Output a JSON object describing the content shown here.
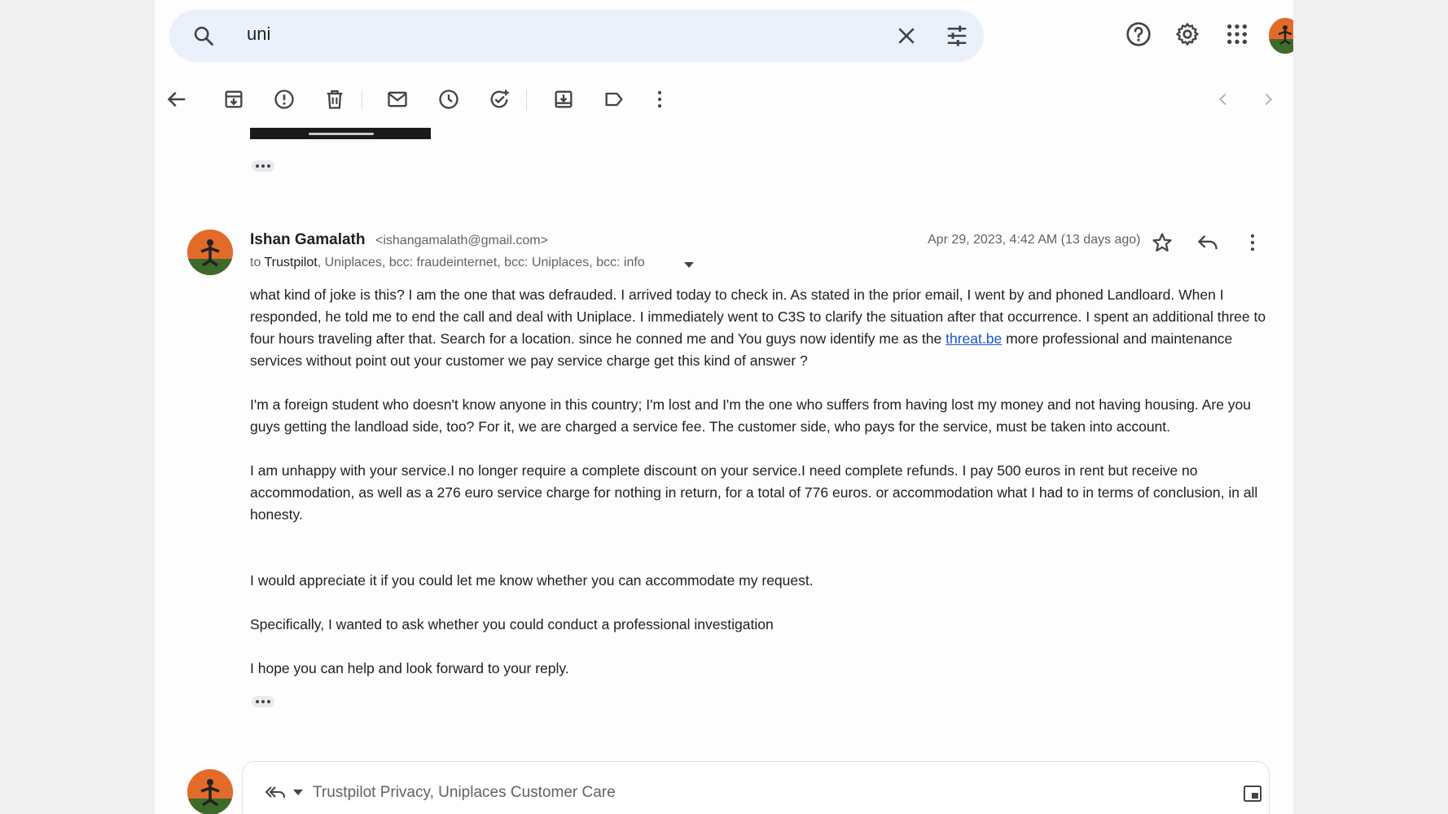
{
  "search": {
    "query": "uni",
    "search_icon": "search-icon",
    "clear_icon": "close-icon",
    "options_icon": "tune-icon"
  },
  "top_icons": [
    "help-icon",
    "gear-icon",
    "apps-grid-icon",
    "account-avatar"
  ],
  "toolbar": {
    "icons": [
      "back-arrow-icon",
      "archive-icon",
      "report-spam-icon",
      "delete-icon",
      "mark-unread-icon",
      "snooze-icon",
      "add-task-icon",
      "move-to-icon",
      "label-icon",
      "more-vertical-icon"
    ],
    "nav": [
      "prev-chevron-icon",
      "next-chevron-icon"
    ]
  },
  "message": {
    "sender_name": "Ishan Gamalath",
    "sender_email": "<ishangamalath@gmail.com>",
    "to_prefix": "to ",
    "to_first": "Trustpilot",
    "to_rest": ", Uniplaces, bcc: fraudeinternet, bcc: Uniplaces, bcc: info",
    "date": "Apr 29, 2023, 4:42 AM (13 days ago)",
    "paragraphs": {
      "p1_before_link": "what kind of joke is this? I am the one that was defrauded. I arrived today to check in. As stated in the prior email, I went by and phoned Landloard. When I responded, he told me to end the call and deal with Uniplace. I immediately went to C3S to clarify the situation after that occurrence. I spent an additional three to four hours traveling after that. Search for a location. since he conned me and You guys now identify me as the ",
      "p1_link": "threat.be",
      "p1_after_link": " more professional and maintenance services without point out your customer we pay service charge get this kind of answer ?",
      "p2": "I'm a foreign student who doesn't know anyone in this country; I'm lost and I'm the one who suffers from having lost my money and not having housing. Are you guys getting the landload side, too? For it, we are charged a service fee. The customer side, who pays for the service, must be taken into account.",
      "p3": "I am unhappy with your service.I no longer require a complete discount on your service.I need complete refunds. I pay 500 euros in rent but receive no accommodation, as well as a 276 euro service charge for nothing in return, for a total of 776 euros. or accommodation what I had to in terms of conclusion, in all honesty.",
      "p4": "I would appreciate it if you could let me know whether you can accommodate my request.",
      "p5": "Specifically, I wanted to ask whether you could conduct a professional investigation",
      "p6": "I hope you can help and look forward to your reply."
    }
  },
  "reply": {
    "recipients": "Trustpilot Privacy, Uniplaces Customer Care"
  },
  "colors": {
    "search_bg": "#eaf1fb",
    "link": "#1a57c8",
    "avatar_orange": "#e36b2a"
  }
}
